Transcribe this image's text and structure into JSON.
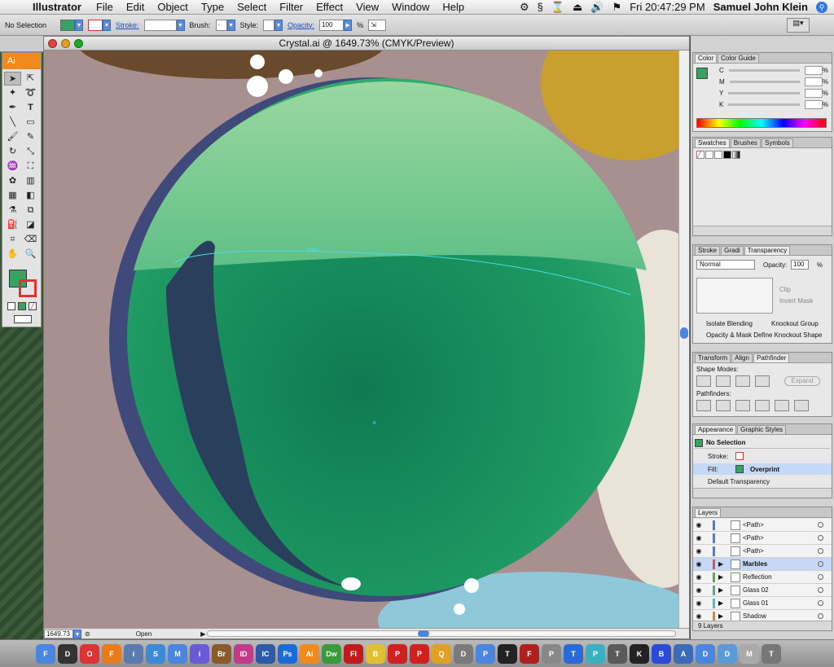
{
  "menubar": {
    "app": "Illustrator",
    "menus": [
      "File",
      "Edit",
      "Object",
      "Type",
      "Select",
      "Filter",
      "Effect",
      "View",
      "Window",
      "Help"
    ],
    "clock": "Fri 20:47:29 PM",
    "user": "Samuel John Klein"
  },
  "controlbar": {
    "selection": "No Selection",
    "stroke_label": "Stroke:",
    "brush_label": "Brush:",
    "brush_value": "·",
    "style_label": "Style:",
    "opacity_label": "Opacity:",
    "opacity_value": "100",
    "opacity_unit": "%"
  },
  "tools": {
    "logo": "Ai"
  },
  "document": {
    "title": "Crystal.ai @ 1649.73% (CMYK/Preview)",
    "path_label": "path",
    "zoom": "1649.73",
    "status": "Open"
  },
  "panels": {
    "color": {
      "tabs": [
        "Color",
        "Color Guide"
      ],
      "channels": [
        "C",
        "M",
        "Y",
        "K"
      ],
      "unit": "%"
    },
    "swatches": {
      "tabs": [
        "Swatches",
        "Brushes",
        "Symbols"
      ]
    },
    "transparency": {
      "tabs": [
        "Stroke",
        "Gradi",
        "Transparency"
      ],
      "mode": "Normal",
      "opacity_label": "Opacity:",
      "opacity_value": "100",
      "unit": "%",
      "clip": "Clip",
      "invert_mask": "Invert Mask",
      "isolate_blending": "Isolate Blending",
      "knockout_group": "Knockout Group",
      "opacity_mask": "Opacity & Mask Define Knockout Shape"
    },
    "pathfinder": {
      "tabs": [
        "Transform",
        "Align",
        "Pathfinder"
      ],
      "shape_modes": "Shape Modes:",
      "expand": "Expand",
      "pathfinders": "Pathfinders:"
    },
    "appearance": {
      "tabs": [
        "Appearance",
        "Graphic Styles"
      ],
      "title": "No Selection",
      "stroke_label": "Stroke:",
      "fill_label": "Fill:",
      "fill_value": "Overprint",
      "default_transparency": "Default Transparency"
    },
    "layers": {
      "tabs": [
        "Layers"
      ],
      "rows": [
        {
          "name": "<Path>",
          "color": "#4b7fd9"
        },
        {
          "name": "<Path>",
          "color": "#4b7fd9"
        },
        {
          "name": "<Path>",
          "color": "#4b7fd9"
        },
        {
          "name": "Marbles",
          "color": "#e05050"
        },
        {
          "name": "Reflection",
          "color": "#50b050"
        },
        {
          "name": "Glass 02",
          "color": "#50b080"
        },
        {
          "name": "Glass 01",
          "color": "#50c0c0"
        },
        {
          "name": "Shadow",
          "color": "#e08030"
        }
      ],
      "count": "9 Layers"
    }
  },
  "colors": {
    "accent_blue": "#4a86e0",
    "fill_green": "#36a263",
    "canvas_bg": "#a89090"
  },
  "dock": {
    "apps": [
      "Finder",
      "Dashboard",
      "Opera",
      "Firefox",
      "iCal",
      "Safari",
      "Mail",
      "iTunes",
      "Br",
      "ID",
      "IC",
      "Ps",
      "Ai",
      "Dw",
      "Fl",
      "Bird",
      "PDF",
      "PDF2",
      "Q",
      "Disk",
      "Preview",
      "Terminal",
      "Flash",
      "Printer",
      "Trophy",
      "Puzzle",
      "Tool",
      "K",
      "Ball",
      "Apps",
      "Docs",
      "Download",
      "Mail2",
      "Trash"
    ]
  }
}
